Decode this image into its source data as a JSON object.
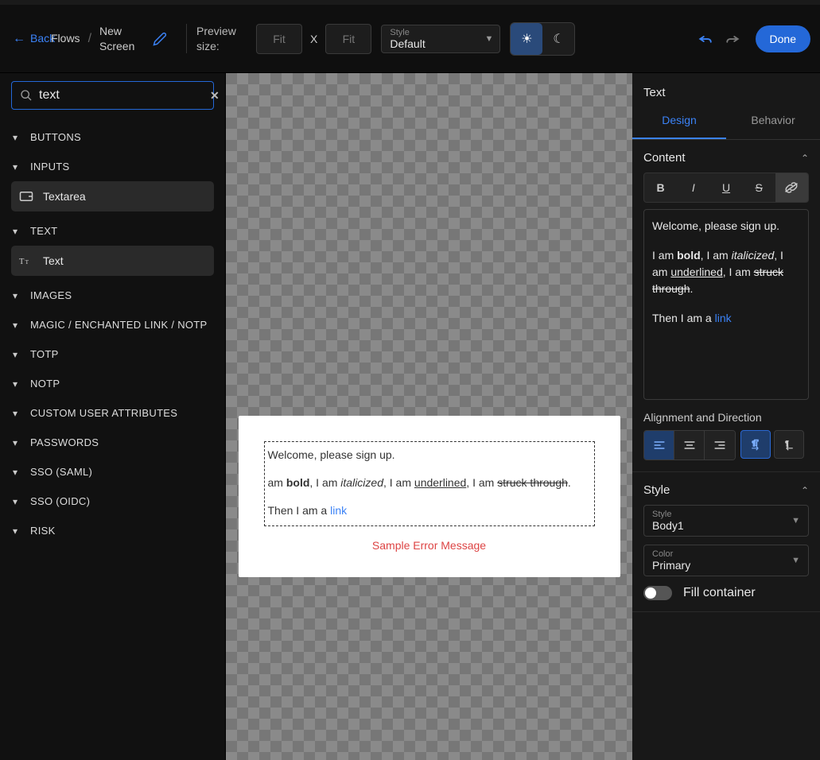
{
  "toolbar": {
    "back": "Back",
    "breadcrumb1": "Flows",
    "breadcrumb2": "New Screen",
    "preview_label": "Preview size:",
    "size_placeholder": "Fit",
    "x": "X",
    "style_label": "Style",
    "style_value": "Default",
    "done": "Done"
  },
  "left": {
    "search_value": "text",
    "categories": [
      "BUTTONS",
      "INPUTS",
      "TEXT",
      "IMAGES",
      "MAGIC / ENCHANTED LINK / NOTP",
      "TOTP",
      "NOTP",
      "CUSTOM USER ATTRIBUTES",
      "PASSWORDS",
      "SSO (SAML)",
      "SSO (OIDC)",
      "RISK"
    ],
    "textarea_item": "Textarea",
    "text_item": "Text"
  },
  "canvas": {
    "p1": "Welcome, please sign up.",
    "p2_prefix": "am ",
    "bold": "bold",
    "p2_mid1": ", I am ",
    "italic": "italicized",
    "p2_mid2": ", I am ",
    "underline": "underlined",
    "p2_mid3": ", I am ",
    "strike": "struck through",
    "p2_end": ".",
    "p3_prefix": "Then I am a ",
    "link": "link",
    "error": "Sample Error Message"
  },
  "right": {
    "title": "Text",
    "tab_design": "Design",
    "tab_behavior": "Behavior",
    "content_head": "Content",
    "rte": {
      "p1": "Welcome, please sign up.",
      "p2a": "I am ",
      "bold": "bold",
      "p2b": ", I am ",
      "italic": "italicized",
      "p2c": ", I am ",
      "underline": "underlined",
      "p2d": ", I am ",
      "strike": "struck through",
      "p2e": ".",
      "p3a": "Then I am a ",
      "link": "link"
    },
    "align_label": "Alignment and Direction",
    "style_head": "Style",
    "style_sel_label": "Style",
    "style_sel_value": "Body1",
    "color_sel_label": "Color",
    "color_sel_value": "Primary",
    "fill_label": "Fill container"
  }
}
